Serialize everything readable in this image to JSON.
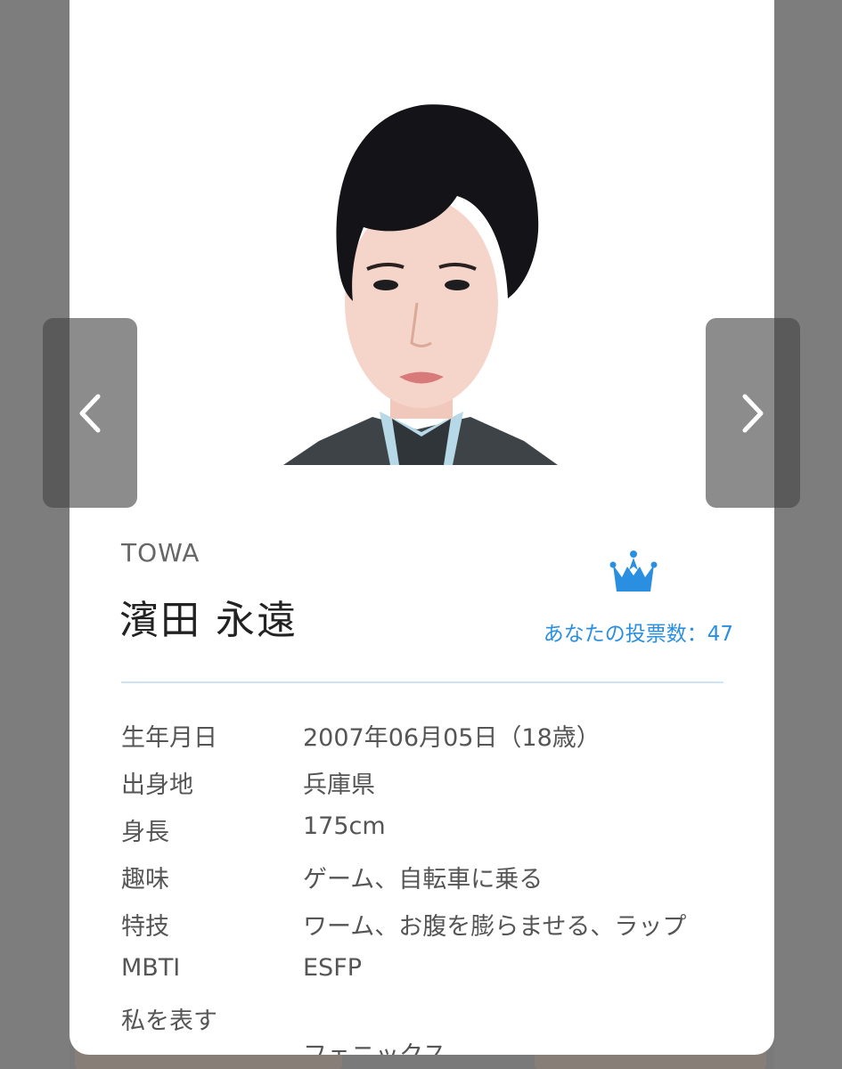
{
  "navigation": {
    "prev_icon": "chevron-left-icon",
    "next_icon": "chevron-right-icon"
  },
  "profile": {
    "name_en": "TOWA",
    "name_ja": "濱田 永遠",
    "vote_icon": "crown-icon",
    "vote_text": "あなたの投票数：47",
    "accent_color": "#2a8fe0"
  },
  "details": [
    {
      "label": "生年月日",
      "value": "2007年06月05日（18歳）"
    },
    {
      "label": "出身地",
      "value": "兵庫県"
    },
    {
      "label": "身長",
      "value": "175cm"
    },
    {
      "label": "趣味",
      "value": "ゲーム、自転車に乗る"
    },
    {
      "label": "特技",
      "value": "ワーム、お腹を膨らませる、ラップ"
    },
    {
      "label": "MBTI",
      "value": "ESFP"
    },
    {
      "label": "私を表す",
      "value": "フェニックス"
    }
  ]
}
